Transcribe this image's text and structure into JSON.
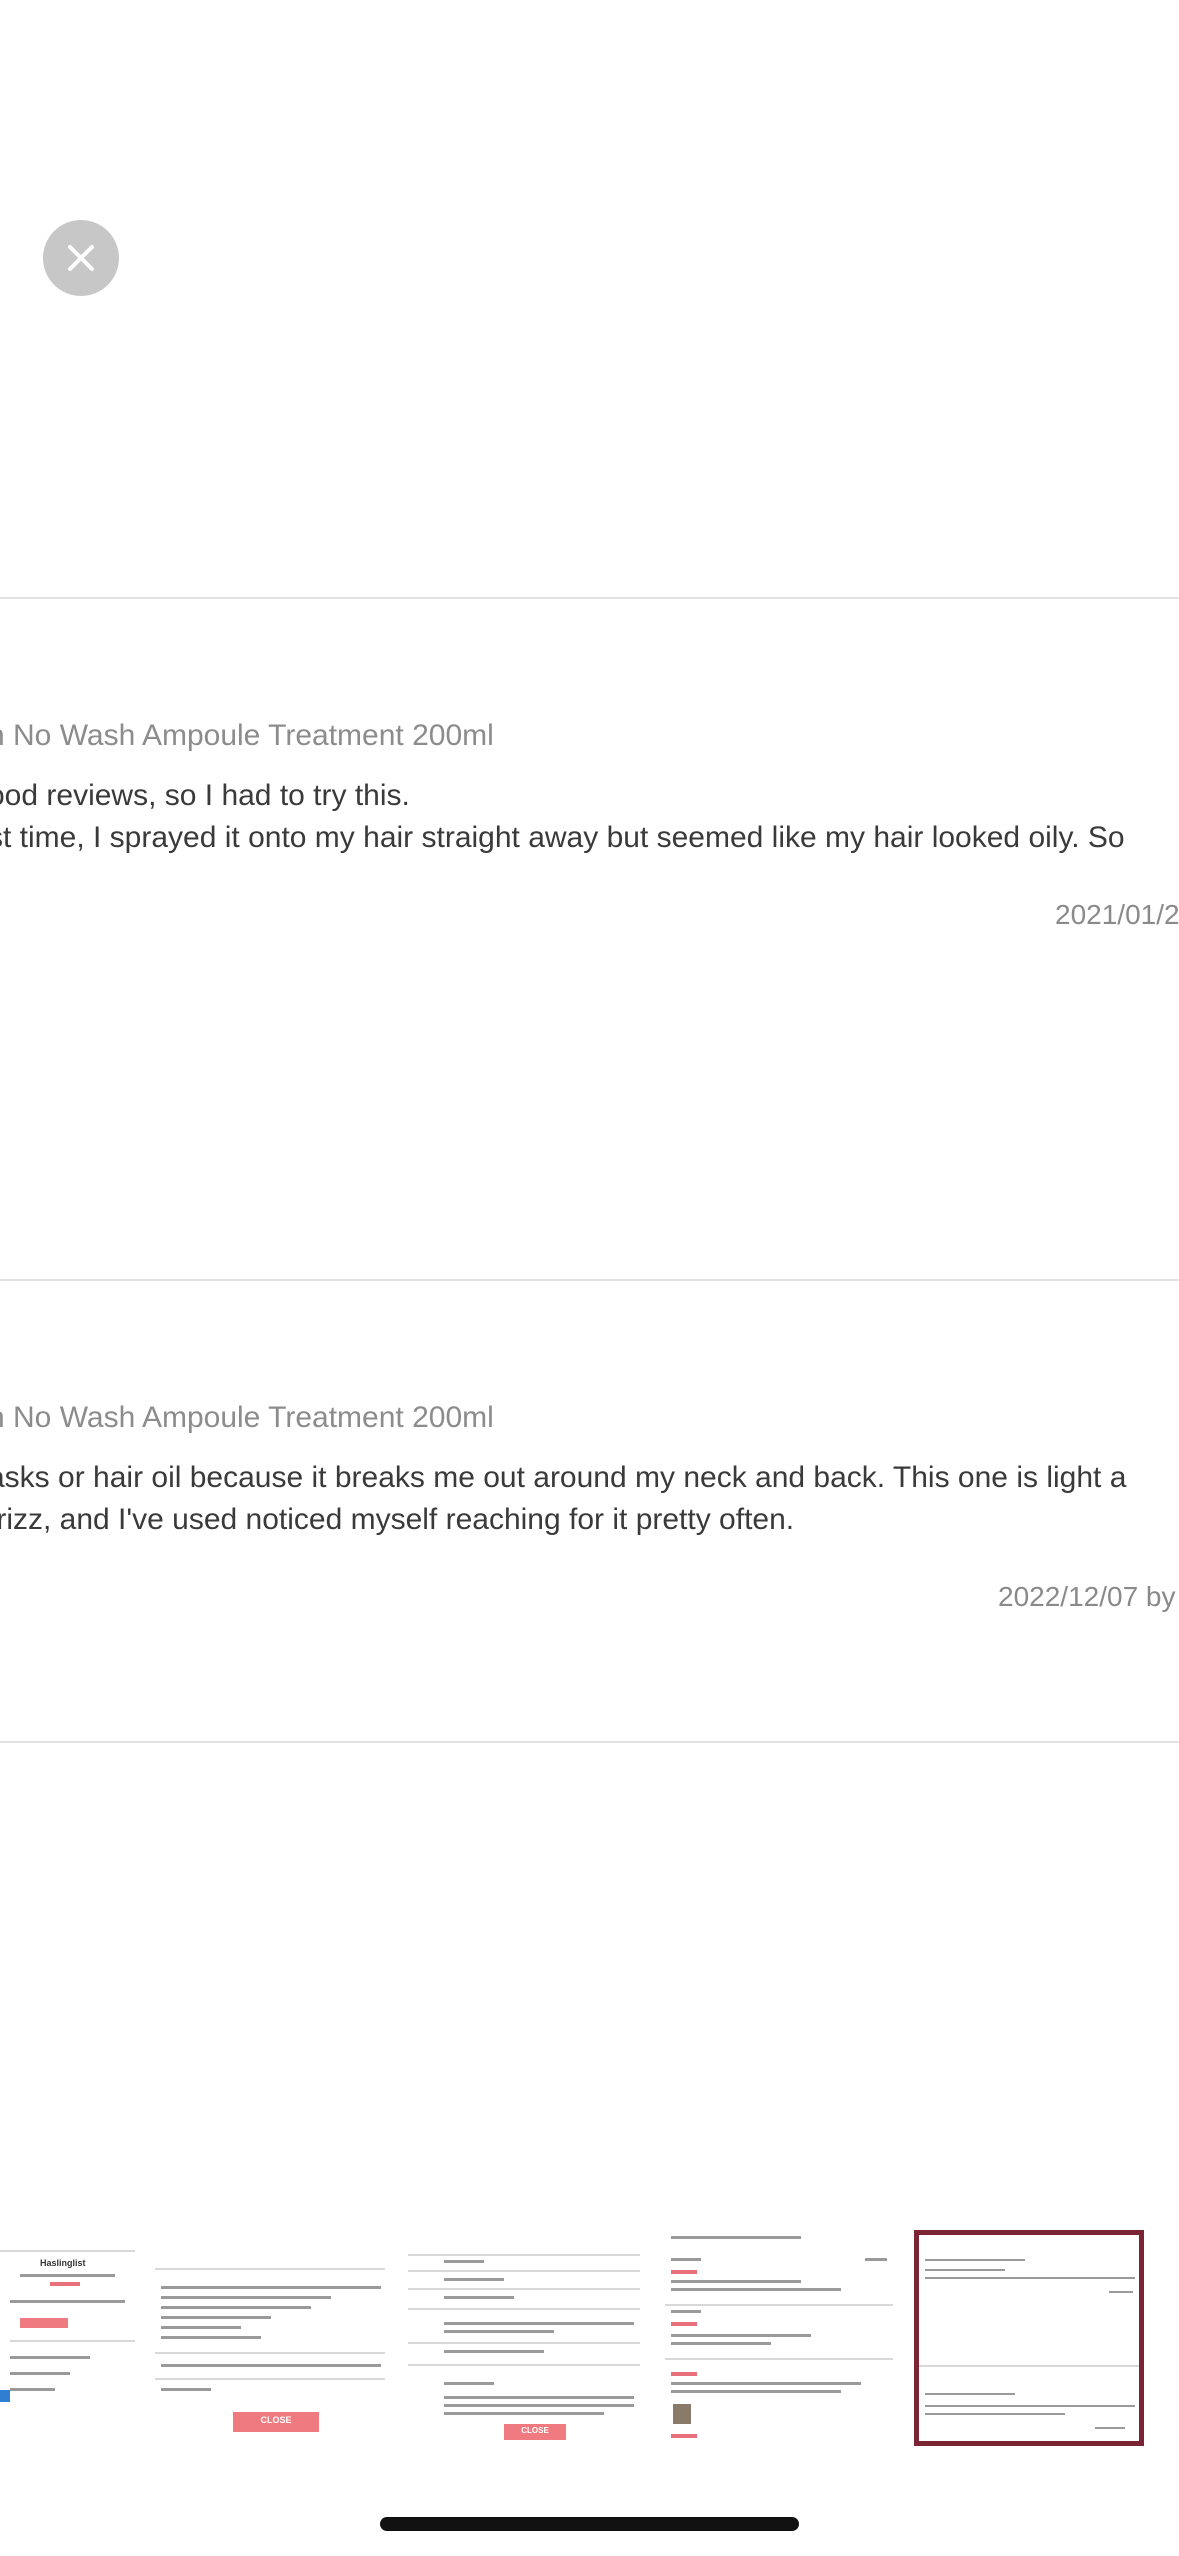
{
  "colors": {
    "accent": "#ef7a80",
    "selected_border": "#7a2434"
  },
  "close_icon": "close-icon",
  "reviews": [
    {
      "product": "h No Wash Ampoule Treatment 200ml",
      "lines": [
        "ood reviews, so I had to try this.",
        "st time, I sprayed it onto my hair straight away but seemed like my hair looked oily. So"
      ],
      "date": "2021/01/2"
    },
    {
      "product": "h No Wash Ampoule Treatment 200ml",
      "lines": [
        "asks or hair oil because it breaks me out around my neck and back. This one is light a",
        "frizz, and I've used noticed myself reaching for it pretty often."
      ],
      "date": "2022/12/07 by"
    }
  ],
  "thumbnails": {
    "count": 5,
    "selected_index": 4,
    "labels": [
      "Haslinglist",
      "CLOSE",
      "CLOSE"
    ]
  }
}
